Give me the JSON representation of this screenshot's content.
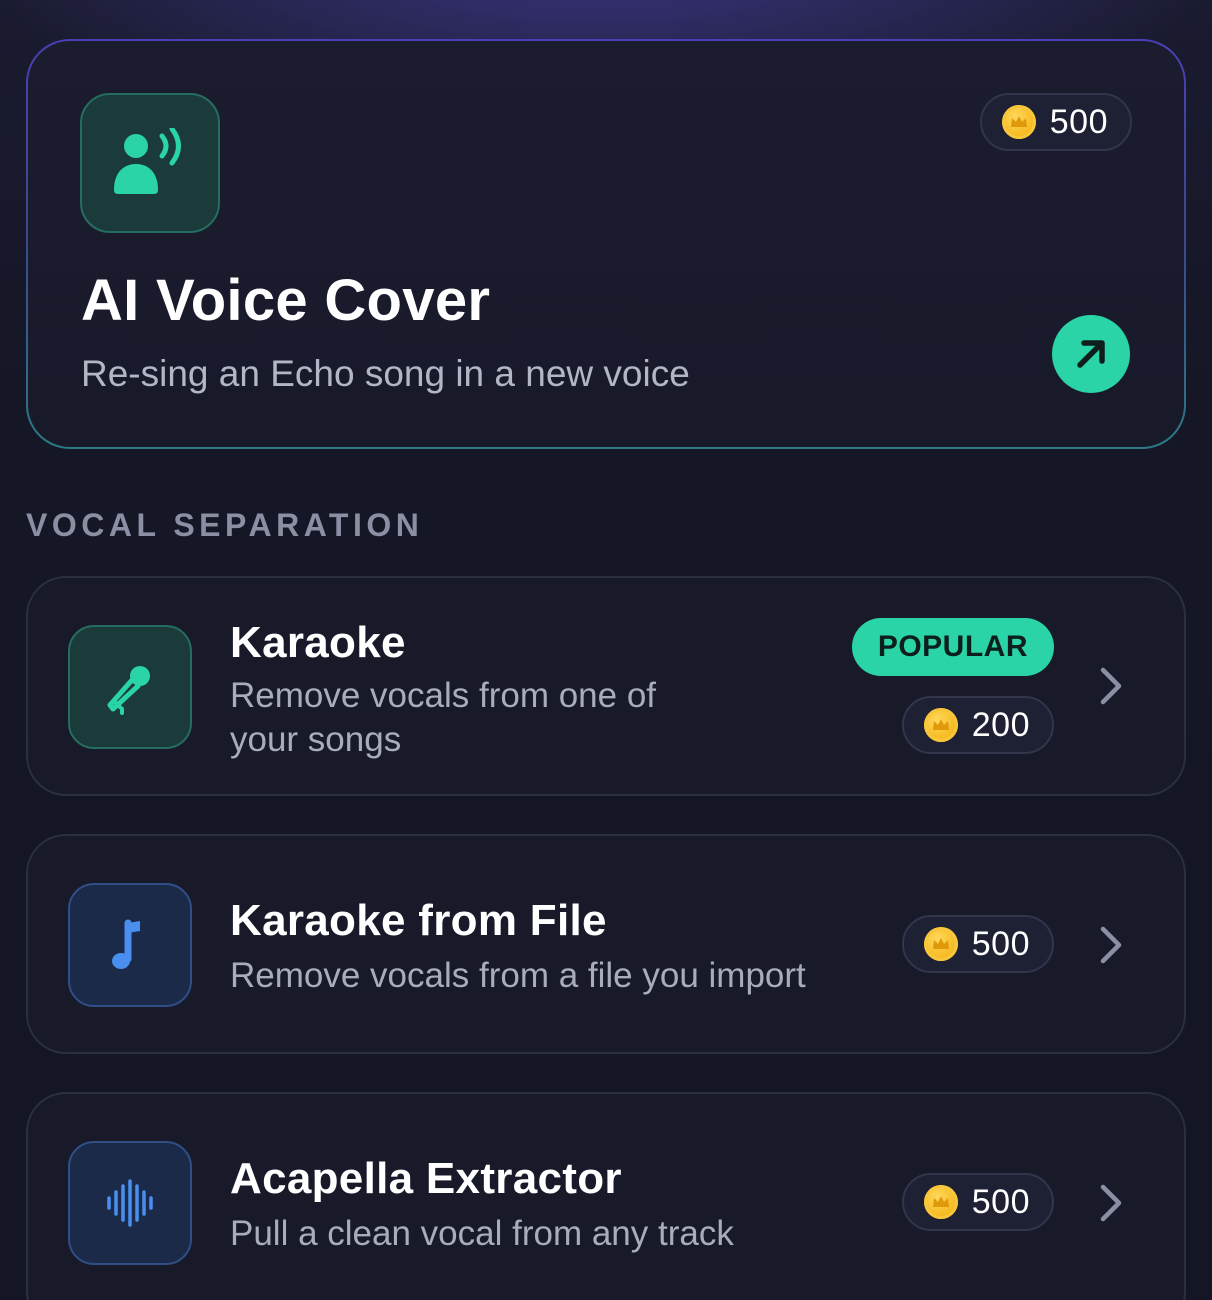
{
  "hero": {
    "title": "AI Voice Cover",
    "subtitle": "Re-sing an Echo song in a new voice",
    "cost": "500",
    "icon": "voice-speaking-icon",
    "action_icon": "arrow-up-right-icon"
  },
  "section": {
    "label": "VOCAL SEPARATION"
  },
  "features": [
    {
      "title": "Karaoke",
      "description": "Remove vocals from one of your songs",
      "badge": "POPULAR",
      "cost": "200",
      "icon": "microphone-icon"
    },
    {
      "title": "Karaoke from File",
      "description": "Remove vocals from a file you import",
      "cost": "500",
      "icon": "music-note-icon"
    },
    {
      "title": "Acapella Extractor",
      "description": "Pull a clean vocal from any track",
      "cost": "500",
      "icon": "waveform-icon"
    }
  ],
  "colors": {
    "accent": "#2ad4a6",
    "background": "#151726",
    "card": "#181a2a",
    "coin": "#f5b71c"
  }
}
